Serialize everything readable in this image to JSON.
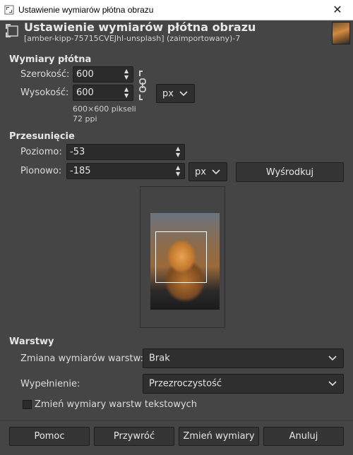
{
  "window": {
    "title": "Ustawienie wymiarów płótna obrazu",
    "close_glyph": "✕"
  },
  "header": {
    "title": "Ustawienie wymiarów płótna obrazu",
    "subtitle": "[amber-kipp-75715CVEJhl-unsplash] (zaimportowany)-7"
  },
  "canvas_size": {
    "section": "Wymiary płótna",
    "width_label": "Szerokość:",
    "width_value": "600",
    "height_label": "Wysokość:",
    "height_value": "600",
    "unit": "px",
    "info_pixels": "600×600 pikseli",
    "info_ppi": "72 ppi"
  },
  "offset": {
    "section": "Przesunięcie",
    "x_label": "Poziomo:",
    "x_value": "-53",
    "y_label": "Pionowo:",
    "y_value": "-185",
    "unit": "px",
    "center_button": "Wyśrodkuj"
  },
  "layers": {
    "section": "Warstwy",
    "resize_label": "Zmiana wymiarów warstw:",
    "resize_value": "Brak",
    "fill_label": "Wypełnienie:",
    "fill_value": "Przezroczystość",
    "text_layers_label": "Zmień wymiary warstw tekstowych",
    "text_layers_checked": false
  },
  "buttons": {
    "help": "Pomoc",
    "reset": "Przywróć",
    "resize": "Zmień wymiary",
    "cancel": "Anuluj"
  },
  "colors": {
    "background": "#454545",
    "entry": "#2b2b2b",
    "text": "#dcdcdc"
  }
}
